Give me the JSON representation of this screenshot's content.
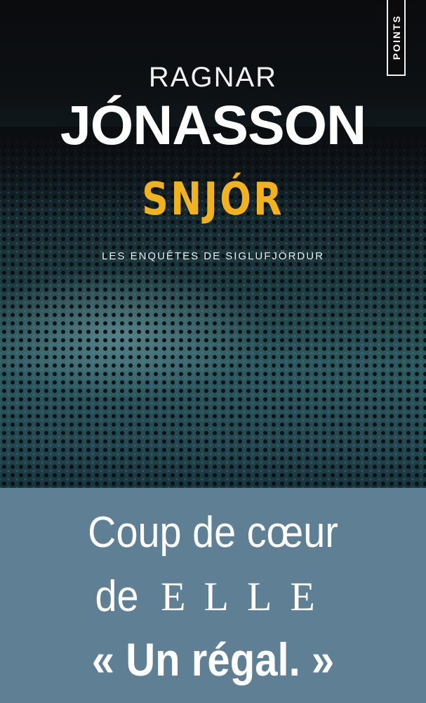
{
  "cover": {
    "author_first": "RAGNAR",
    "author_last": "JÓNASSON",
    "title": "SNJÓR",
    "series": "LES ENQUÊTES DE SIGLUFJÖRDUR",
    "publisher": "POINTS"
  },
  "band": {
    "line1": "Coup de cœur",
    "line2_prefix": "de",
    "magazine": "ELLE",
    "quote": "« Un régal. »"
  },
  "colors": {
    "title": "#f0b21f",
    "band": "#5f7f95",
    "text": "#ffffff"
  }
}
